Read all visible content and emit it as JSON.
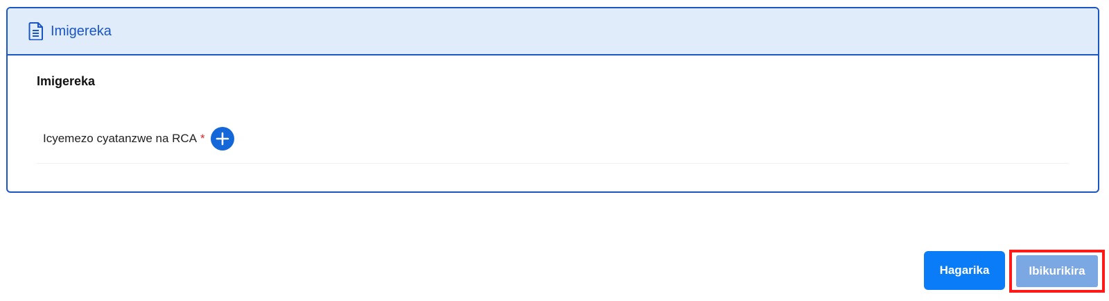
{
  "card": {
    "header_title": "Imigereka",
    "header_icon": "file-document-icon",
    "section_title": "Imigereka",
    "field": {
      "label": "Icyemezo cyatanzwe na RCA",
      "required_mark": "*",
      "add_icon": "plus-circle-icon"
    }
  },
  "actions": {
    "cancel_label": "Hagarika",
    "submit_label": "Ibikurikira"
  },
  "colors": {
    "primary": "#1a55c4",
    "header_bg": "#e0ecf9",
    "cancel_bg": "#0a7cf7",
    "submit_bg": "#7ba7e3",
    "highlight": "#ff1a1a",
    "required": "#e02424"
  }
}
